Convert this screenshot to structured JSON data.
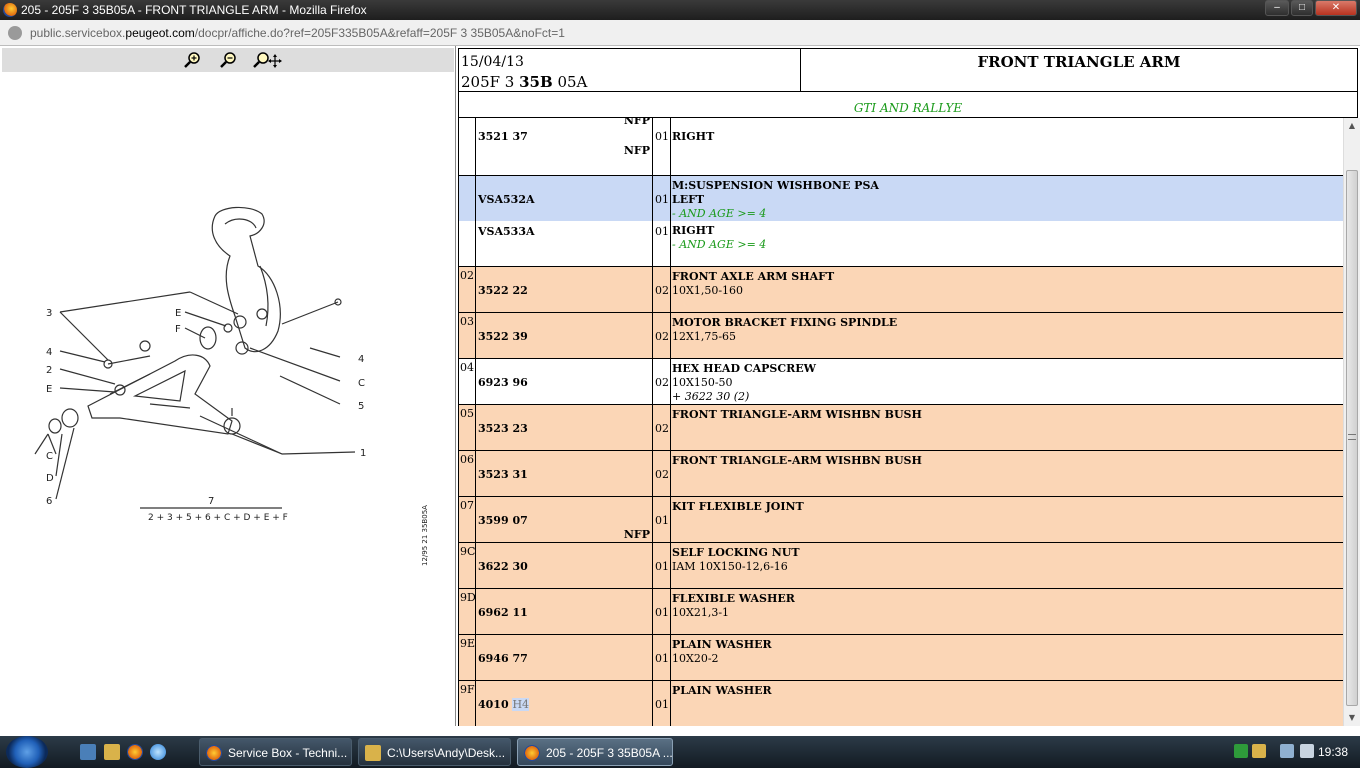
{
  "window": {
    "title": "205 - 205F 3 35B05A - FRONT TRIANGLE ARM - Mozilla Firefox",
    "url_prefix": "public.servicebox.",
    "url_domain": "peugeot.com",
    "url_suffix": "/docpr/affiche.do?ref=205F335B05A&refaff=205F 3 35B05A&noFct=1",
    "minimize": "‒",
    "maximize": "□",
    "close": "✕"
  },
  "doc": {
    "date": "15/04/13",
    "ref_a": "205F 3 ",
    "ref_b": "35B",
    "ref_c": " 05A",
    "title": "FRONT TRIANGLE ARM",
    "subtitle": "GTI AND RALLYE"
  },
  "diagram": {
    "labels": [
      "3",
      "4",
      "2",
      "E",
      "C",
      "D",
      "6",
      "E",
      "F",
      "4",
      "C",
      "5",
      "1",
      "7"
    ],
    "formula": "2 + 3 + 5 + 6 + C + D + E + F",
    "code": "12/95  21  35B05A"
  },
  "rows": [
    {
      "pos": "",
      "part": "3521 37",
      "nfp_top": "NFP",
      "nfp_bottom": "NFP",
      "qty": "01",
      "d1": "RIGHT",
      "color": "white"
    },
    {
      "pos": "",
      "part": "VSA532A",
      "qty": "01",
      "d1": "M:SUSPENSION WISHBONE PSA",
      "d1b": "LEFT",
      "cond": "- AND AGE >= 4",
      "color": "blue"
    },
    {
      "pos": "",
      "part": "VSA533A",
      "qty": "01",
      "d1": "RIGHT",
      "cond": "- AND AGE >= 4",
      "color": "white"
    },
    {
      "pos": "02",
      "part": "3522 22",
      "qty": "02",
      "d1": "FRONT AXLE ARM SHAFT",
      "d2": "10X1,50-160",
      "color": "peach"
    },
    {
      "pos": "03",
      "part": "3522 39",
      "qty": "02",
      "d1": "MOTOR BRACKET FIXING SPINDLE",
      "d2": "12X1,75-65",
      "color": "peach"
    },
    {
      "pos": "04",
      "part": "6923 96",
      "qty": "02",
      "d1": "HEX HEAD CAPSCREW",
      "d2": "10X150-50",
      "note": "+ 3622 30 (2)",
      "color": "white"
    },
    {
      "pos": "05",
      "part": "3523 23",
      "qty": "02",
      "d1": "FRONT TRIANGLE-ARM WISHBN BUSH",
      "color": "peach"
    },
    {
      "pos": "06",
      "part": "3523 31",
      "qty": "02",
      "d1": "FRONT TRIANGLE-ARM WISHBN BUSH",
      "color": "peach"
    },
    {
      "pos": "07",
      "part": "3599 07",
      "nfp_bottom": "NFP",
      "qty": "01",
      "d1": "KIT FLEXIBLE JOINT",
      "color": "peach"
    },
    {
      "pos": "9C",
      "part": "3622 30",
      "qty": "01",
      "d1": "SELF LOCKING NUT",
      "d2": "IAM 10X150-12,6-16",
      "color": "peach"
    },
    {
      "pos": "9D",
      "part": "6962 11",
      "qty": "01",
      "d1": "FLEXIBLE WASHER",
      "d2": "10X21,3-1",
      "color": "peach"
    },
    {
      "pos": "9E",
      "part": "6946 77",
      "qty": "01",
      "d1": "PLAIN WASHER",
      "d2": "10X20-2",
      "color": "peach"
    },
    {
      "pos": "9F",
      "part": "4010",
      "part_hl": "H4",
      "qty": "01",
      "d1": "PLAIN WASHER",
      "color": "peach"
    }
  ],
  "taskbar": {
    "tasks": [
      {
        "label": "Service Box - Techni..."
      },
      {
        "label": "C:\\Users\\Andy\\Desk..."
      },
      {
        "label": "205 - 205F 3 35B05A ..."
      }
    ],
    "clock": "19:38"
  },
  "colors": {
    "peach": "#fbd6b6",
    "blue": "#c9d9f5",
    "green_text": "#1a9a1a"
  }
}
